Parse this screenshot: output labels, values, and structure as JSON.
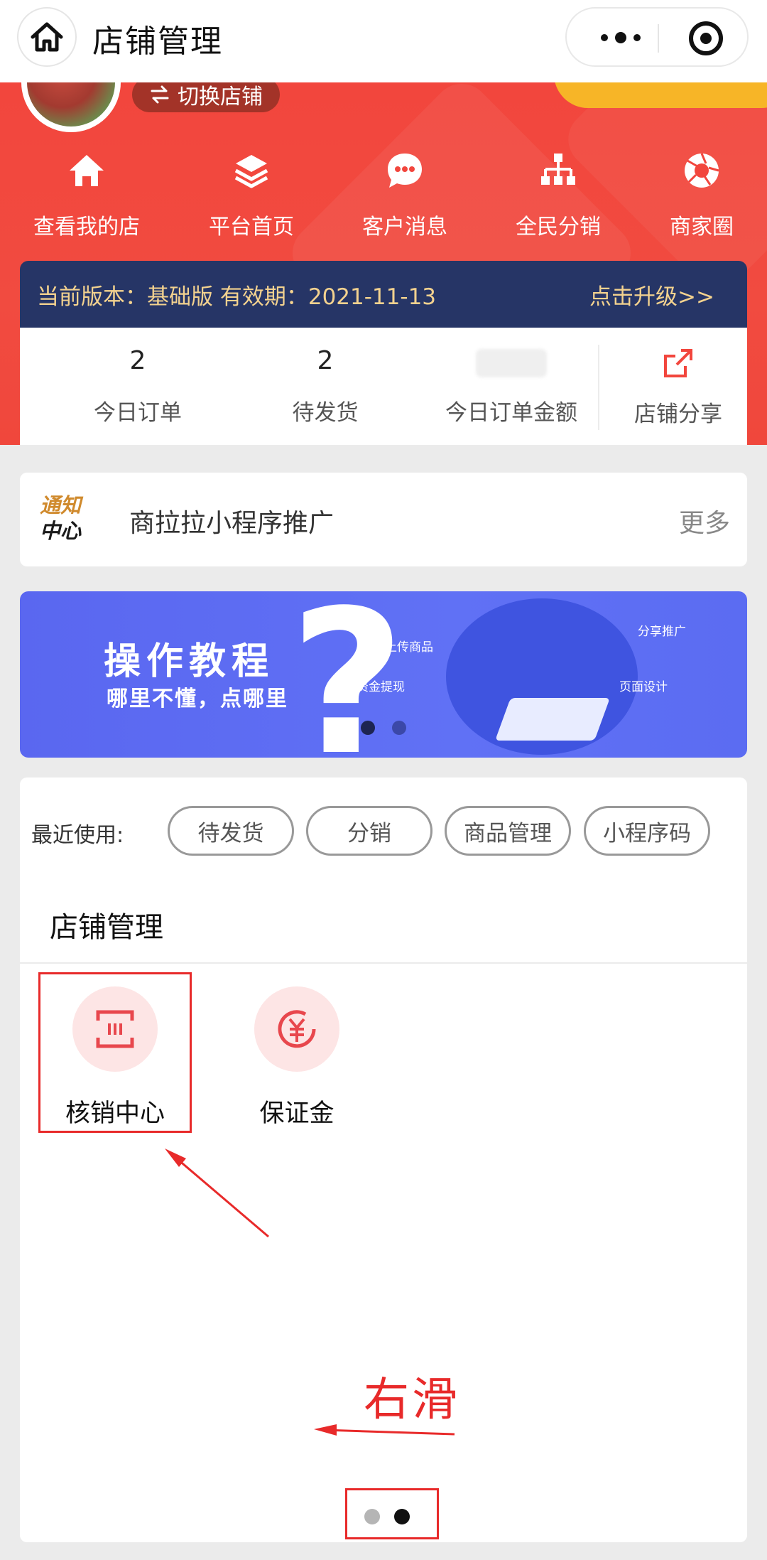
{
  "nav": {
    "title": "店铺管理"
  },
  "hero": {
    "switch_shop": "切换店铺",
    "quick_links": [
      {
        "label": "查看我的店",
        "icon": "home-icon"
      },
      {
        "label": "平台首页",
        "icon": "layers-icon"
      },
      {
        "label": "客户消息",
        "icon": "chat-bubble-icon"
      },
      {
        "label": "全民分销",
        "icon": "org-chart-icon"
      },
      {
        "label": "商家圈",
        "icon": "aperture-icon"
      }
    ]
  },
  "version": {
    "info": "当前版本：基础版 有效期：2021-11-13",
    "upgrade": "点击升级>>"
  },
  "stats": {
    "today_orders": {
      "value": "2",
      "label": "今日订单"
    },
    "pending_ship": {
      "value": "2",
      "label": "待发货"
    },
    "today_amount": {
      "label": "今日订单金额"
    },
    "share": {
      "label": "店铺分享"
    }
  },
  "notice": {
    "logo_line1": "通知",
    "logo_line2": "中心",
    "text": "商拉拉小程序推广",
    "more": "更多"
  },
  "banner": {
    "title": "操作教程",
    "subtitle": "哪里不懂，点哪里",
    "tags": [
      "上传商品",
      "资金提现",
      "分享推广",
      "页面设计"
    ],
    "active_slide": 1,
    "slide_count": 2
  },
  "tools": {
    "recent_label": "最近使用:",
    "recent_chips": [
      "待发货",
      "分销",
      "商品管理",
      "小程序码"
    ],
    "section_title": "店铺管理",
    "items": [
      {
        "label": "核销中心",
        "icon": "verify-scan-icon"
      },
      {
        "label": "保证金",
        "icon": "yen-deposit-icon"
      }
    ],
    "annotation": "右滑",
    "page_count": 2,
    "active_page": 2
  },
  "colors": {
    "brand_red": "#f2463d",
    "version_bg": "#263566",
    "version_text": "#f3d28f",
    "annotation_red": "#e82a2a",
    "banner_blue": "#5a67f0"
  }
}
